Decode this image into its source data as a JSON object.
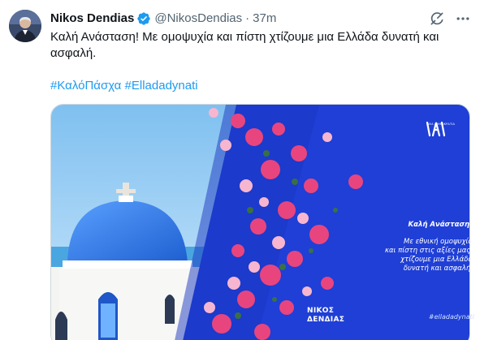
{
  "author": {
    "name": "Nikos Dendias",
    "handle": "@NikosDendias",
    "separator": "·",
    "time": "37m"
  },
  "tweet": {
    "text": "Καλή Ανάσταση! Με ομοψυχία και πίστη χτίζουμε μια Ελλάδα δυνατή και ασφαλή.",
    "hashtags": [
      "#ΚαλόΠάσχα",
      "#Elladadynati"
    ]
  },
  "media": {
    "logo_subtext": "ΝΕΑ ΔΗΜΟΚΡΑΤΙΑ",
    "greeting": "Καλή Ανάσταση!",
    "lines": [
      "Με εθνική ομοψυχία",
      "και πίστη στις αξίες μας,",
      "χτίζουμε μια Ελλάδα",
      "δυνατή και ασφαλή."
    ],
    "name_line1": "ΝΙΚΟΣ",
    "name_line2": "ΔΕΝΔΙΑΣ",
    "hashtag": "#elladadynati"
  },
  "icons": {
    "verified": "verified-badge-icon",
    "grok": "grok-icon",
    "more": "more-icon"
  },
  "colors": {
    "link": "#1d9bf0",
    "panel_blue": "#1f3fd6",
    "verified": "#1d9bf0"
  }
}
